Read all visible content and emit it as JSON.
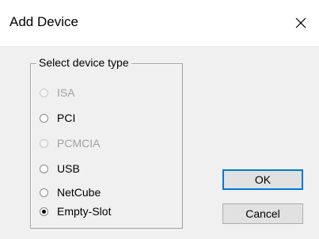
{
  "window": {
    "title": "Add Device"
  },
  "group": {
    "legend": "Select device type",
    "options": [
      {
        "label": "ISA",
        "enabled": false,
        "selected": false
      },
      {
        "label": "PCI",
        "enabled": true,
        "selected": false
      },
      {
        "label": "PCMCIA",
        "enabled": false,
        "selected": false
      },
      {
        "label": "USB",
        "enabled": true,
        "selected": false
      },
      {
        "label": "NetCube",
        "enabled": true,
        "selected": false
      },
      {
        "label": "Empty-Slot",
        "enabled": true,
        "selected": true
      }
    ]
  },
  "buttons": {
    "ok": "OK",
    "cancel": "Cancel"
  },
  "colors": {
    "default_button_border": "#0078d7",
    "disabled_text": "#a0a0a0",
    "dialog_background": "#f0f0f0"
  },
  "icons": {
    "close": "close-icon"
  }
}
